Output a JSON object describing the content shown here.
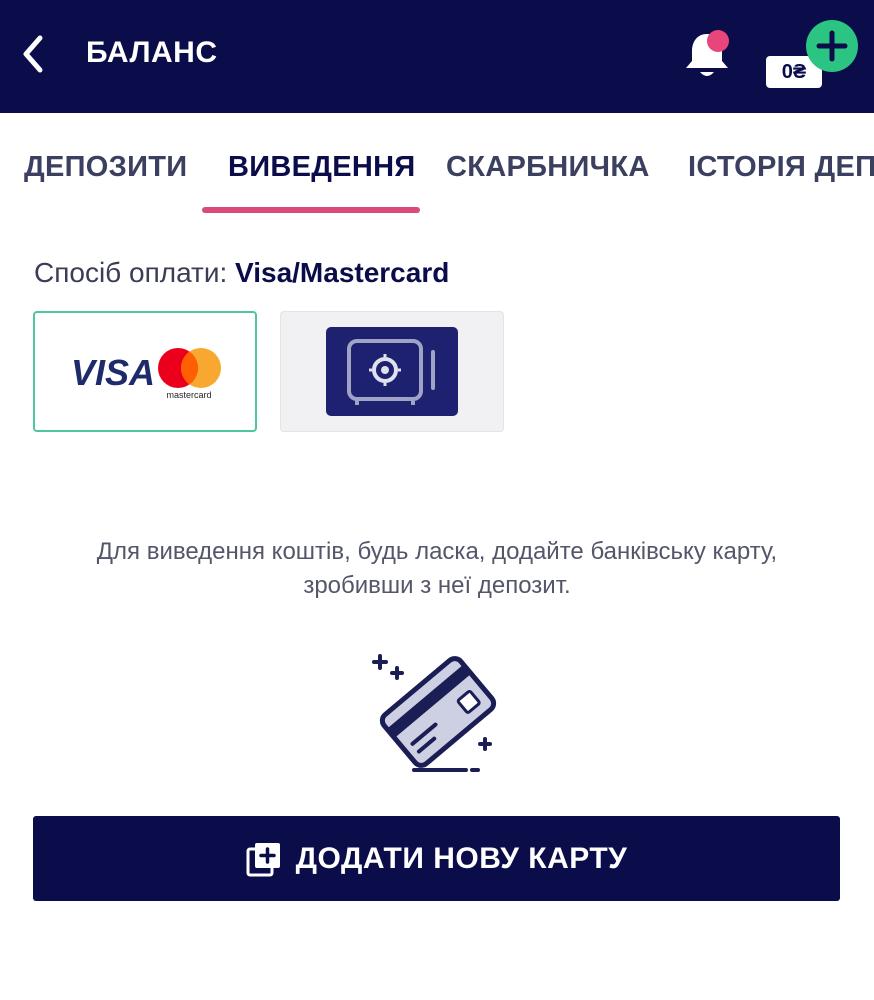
{
  "header": {
    "title": "БАЛАНС",
    "balance": "0₴",
    "colors": {
      "background": "#0b0c4a",
      "notification_dot": "#e8457a",
      "add_funds": "#2cc483"
    }
  },
  "tabs": [
    {
      "label": "ДЕПОЗИТИ",
      "active": false
    },
    {
      "label": "ВИВЕДЕННЯ",
      "active": true
    },
    {
      "label": "СКАРБНИЧКА",
      "active": false
    },
    {
      "label": "ІСТОРІЯ ДЕПОЗИТІВ",
      "active": false
    }
  ],
  "payment": {
    "method_label": "Спосіб оплати:",
    "method_value": "Visa/Mastercard",
    "methods": [
      {
        "name": "visa-mastercard",
        "brand_text": "VISA",
        "sub_text": "mastercard",
        "selected": true
      },
      {
        "name": "safe-box",
        "icon": "safe-icon",
        "selected": false
      }
    ]
  },
  "info": {
    "line1": "Для виведення коштів, будь ласка, додайте банківську карту,",
    "line2": "зробивши з неї депозит."
  },
  "add_card_button": {
    "label": "ДОДАТИ НОВУ КАРТУ",
    "icon": "add-card-icon"
  },
  "colors": {
    "accent": "#d9497a",
    "primary": "#0b0c4a",
    "selected_border": "#4fc79a"
  }
}
